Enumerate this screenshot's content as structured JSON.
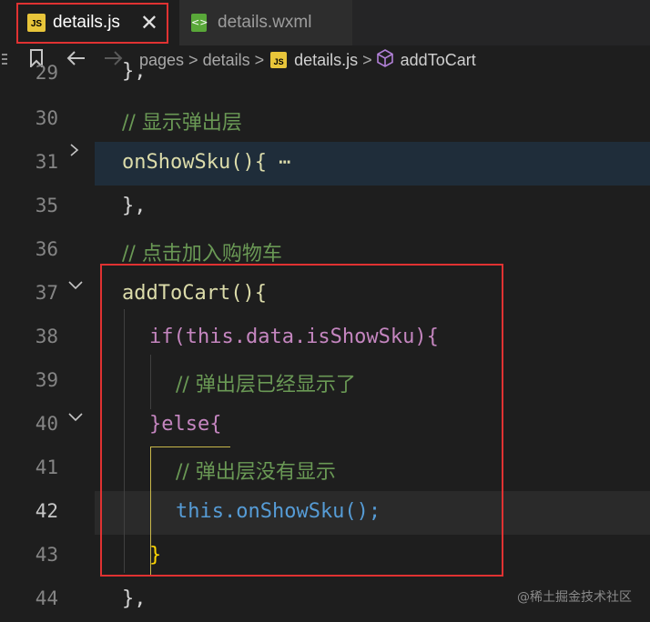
{
  "tabs": [
    {
      "label": "details.js",
      "icon": "js-file-icon",
      "active": true,
      "badge": "JS"
    },
    {
      "label": "details.wxml",
      "icon": "wxml-file-icon",
      "active": false,
      "badge": "<>"
    }
  ],
  "close_glyph": "✕",
  "breadcrumb": {
    "items": [
      "pages",
      "details",
      "details.js",
      "addToCart"
    ],
    "separator": ">"
  },
  "lines": [
    {
      "n": "29",
      "text": "},"
    },
    {
      "n": "30",
      "text": "// 显示弹出层"
    },
    {
      "n": "31",
      "text": "onShowSku(){ ⋯",
      "folded": true
    },
    {
      "n": "35",
      "text": "},"
    },
    {
      "n": "36",
      "text": "// 点击加入购物车"
    },
    {
      "n": "37",
      "text": "addToCart(){"
    },
    {
      "n": "38",
      "text": "if(this.data.isShowSku){"
    },
    {
      "n": "39",
      "text": "// 弹出层已经显示了"
    },
    {
      "n": "40",
      "text": "}else{"
    },
    {
      "n": "41",
      "text": "// 弹出层没有显示"
    },
    {
      "n": "42",
      "text": "this.onShowSku();",
      "current": true
    },
    {
      "n": "43",
      "text": "}"
    },
    {
      "n": "44",
      "text": "},"
    }
  ],
  "watermark": "@稀土掘金技术社区",
  "colors": {
    "accent_red": "#e03232",
    "js_badge": "#e8c53a",
    "wxml_icon": "#59a839"
  }
}
